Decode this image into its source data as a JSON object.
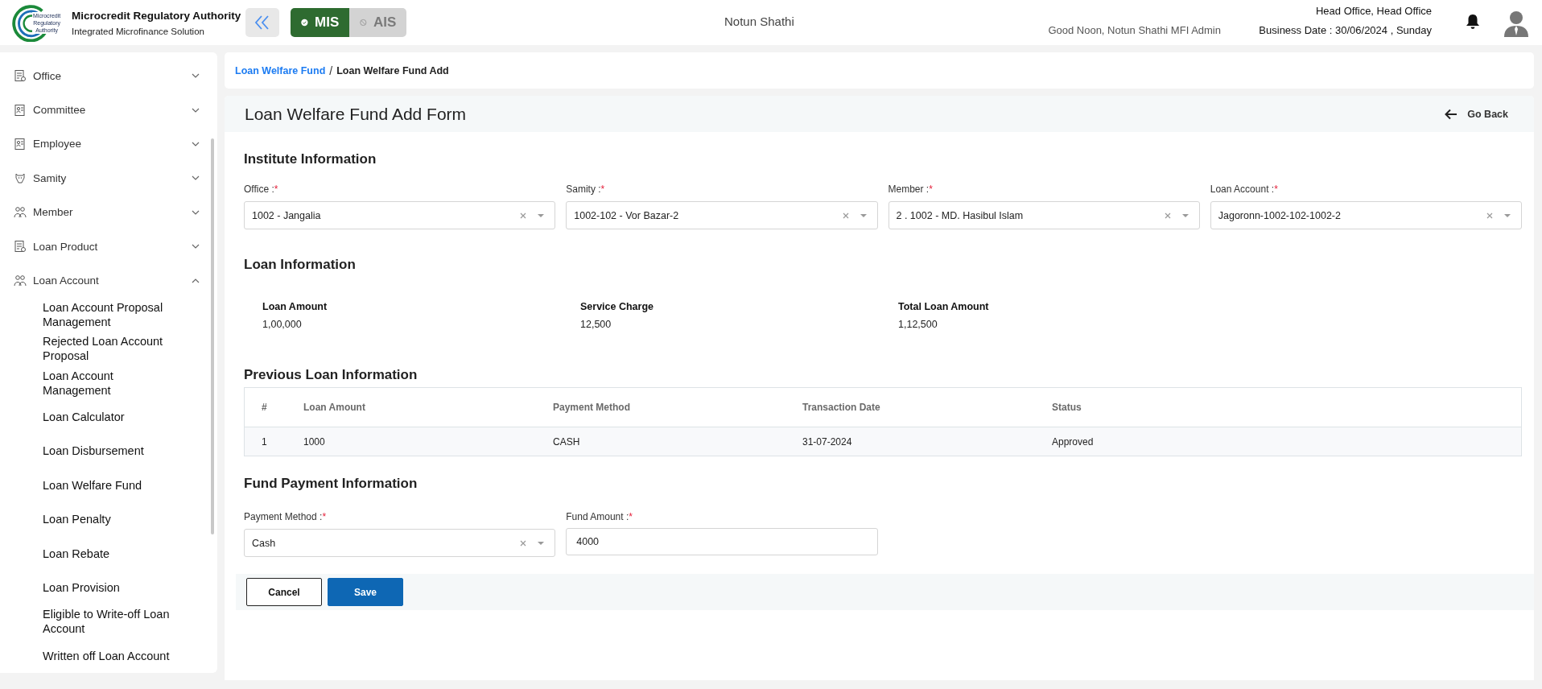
{
  "header": {
    "logo_caption": [
      "Microcredit",
      "Regulatory",
      "Authority"
    ],
    "title": "Microcredit Regulatory Authority",
    "subtitle": "Integrated Microfinance Solution",
    "modules": [
      {
        "label": "MIS",
        "selected": true
      },
      {
        "label": "AIS",
        "selected": false
      }
    ],
    "organization": "Notun Shathi",
    "greeting": "Good Noon, Notun Shathi MFI Admin",
    "office": "Head Office, Head Office",
    "business_date": "Business Date : 30/06/2024 , Sunday"
  },
  "sidebar": {
    "items": [
      {
        "label": "Office",
        "kind": "document",
        "expanded": false
      },
      {
        "label": "Committee",
        "kind": "id-card",
        "expanded": false
      },
      {
        "label": "Employee",
        "kind": "id-card",
        "expanded": false
      },
      {
        "label": "Samity",
        "kind": "animal",
        "expanded": false
      },
      {
        "label": "Member",
        "kind": "people",
        "expanded": false
      },
      {
        "label": "Loan Product",
        "kind": "document",
        "expanded": false
      },
      {
        "label": "Loan Account",
        "kind": "people",
        "expanded": true,
        "children": [
          {
            "label": "Loan Account Proposal Management"
          },
          {
            "label": "Rejected Loan Account Proposal"
          },
          {
            "label": "Loan Account Management"
          },
          {
            "label": "Loan Calculator"
          },
          {
            "label": "Loan Disbursement"
          },
          {
            "label": "Loan Welfare Fund"
          },
          {
            "label": "Loan Penalty"
          },
          {
            "label": "Loan Rebate"
          },
          {
            "label": "Loan Provision"
          },
          {
            "label": "Eligible to Write-off Loan Account"
          },
          {
            "label": "Written off Loan Account"
          }
        ]
      }
    ]
  },
  "breadcrumb": {
    "separator": "/",
    "items": [
      {
        "label": "Loan Welfare Fund",
        "link": true
      },
      {
        "label": "Loan Welfare Fund Add",
        "link": false
      }
    ]
  },
  "form": {
    "title": "Loan Welfare Fund Add Form",
    "go_back": "Go Back",
    "institute": {
      "heading": "Institute Information",
      "fields": [
        {
          "label": "Office :",
          "required_mark": "*",
          "kind": "select",
          "value": "1002 - Jangalia"
        },
        {
          "label": "Samity :",
          "required_mark": "*",
          "kind": "select",
          "value": "1002-102 - Vor Bazar-2"
        },
        {
          "label": "Member :",
          "required_mark": "*",
          "kind": "select",
          "value": "2 . 1002 - MD. Hasibul Islam"
        },
        {
          "label": "Loan Account :",
          "required_mark": "*",
          "kind": "select",
          "value": "Jagoronn-1002-102-1002-2"
        }
      ]
    },
    "loan_information": {
      "heading": "Loan Information",
      "items": [
        {
          "label": "Loan Amount",
          "value": "1,00,000"
        },
        {
          "label": "Service Charge",
          "value": "12,500"
        },
        {
          "label": "Total Loan Amount",
          "value": "1,12,500"
        }
      ]
    },
    "previous_loans": {
      "heading": "Previous Loan Information",
      "columns": [
        "#",
        "Loan Amount",
        "Payment Method",
        "Transaction Date",
        "Status"
      ],
      "rows": [
        [
          "1",
          "1000",
          "CASH",
          "31-07-2024",
          "Approved"
        ]
      ]
    },
    "fund_payment": {
      "heading": "Fund Payment Information",
      "fields": [
        {
          "label": "Payment Method :",
          "required_mark": "*",
          "kind": "select",
          "value": "Cash"
        },
        {
          "label": "Fund Amount :",
          "required_mark": "*",
          "kind": "input",
          "value": "4000"
        }
      ]
    },
    "buttons": [
      {
        "label": "Cancel",
        "kind": "secondary"
      },
      {
        "label": "Save",
        "kind": "primary"
      }
    ]
  }
}
